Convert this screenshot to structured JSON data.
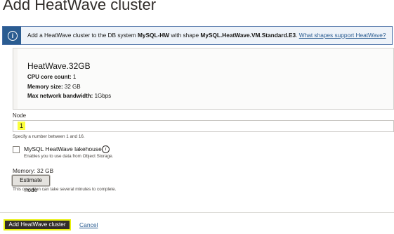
{
  "dialog": {
    "title": "Add HeatWave cluster"
  },
  "info_banner": {
    "icon": "info-icon",
    "text_prefix": "Add a HeatWave cluster to the DB system",
    "db_system": "MySQL-HW",
    "text_middle": "with shape",
    "shape": "MySQL.HeatWave.VM.Standard.E3",
    "text_suffix": ".",
    "link": "What shapes support HeatWave?"
  },
  "shape_card": {
    "name": "HeatWave.32GB",
    "cpu_label": "CPU core count:",
    "cpu_value": "1",
    "memory_label": "Memory size:",
    "memory_value": "32 GB",
    "bandwidth_label": "Max network bandwidth:",
    "bandwidth_value": "1Gbps"
  },
  "node": {
    "label": "Node",
    "value": "1",
    "hint": "Specify a number between 1 and 16."
  },
  "lakehouse": {
    "label": "MySQL HeatWave lakehouse",
    "checked": false,
    "hint": "Enables you to use data from Object Storage."
  },
  "memory": {
    "label": "Memory:",
    "value": "32 GB"
  },
  "estimate": {
    "button": "Estimate node",
    "hint": "This operation can take several minutes to complete."
  },
  "footer": {
    "primary": "Add HeatWave cluster",
    "cancel": "Cancel"
  },
  "colors": {
    "accent": "#2a5c91",
    "primary_button": "#312d2a",
    "highlight": "#fbff3c"
  }
}
